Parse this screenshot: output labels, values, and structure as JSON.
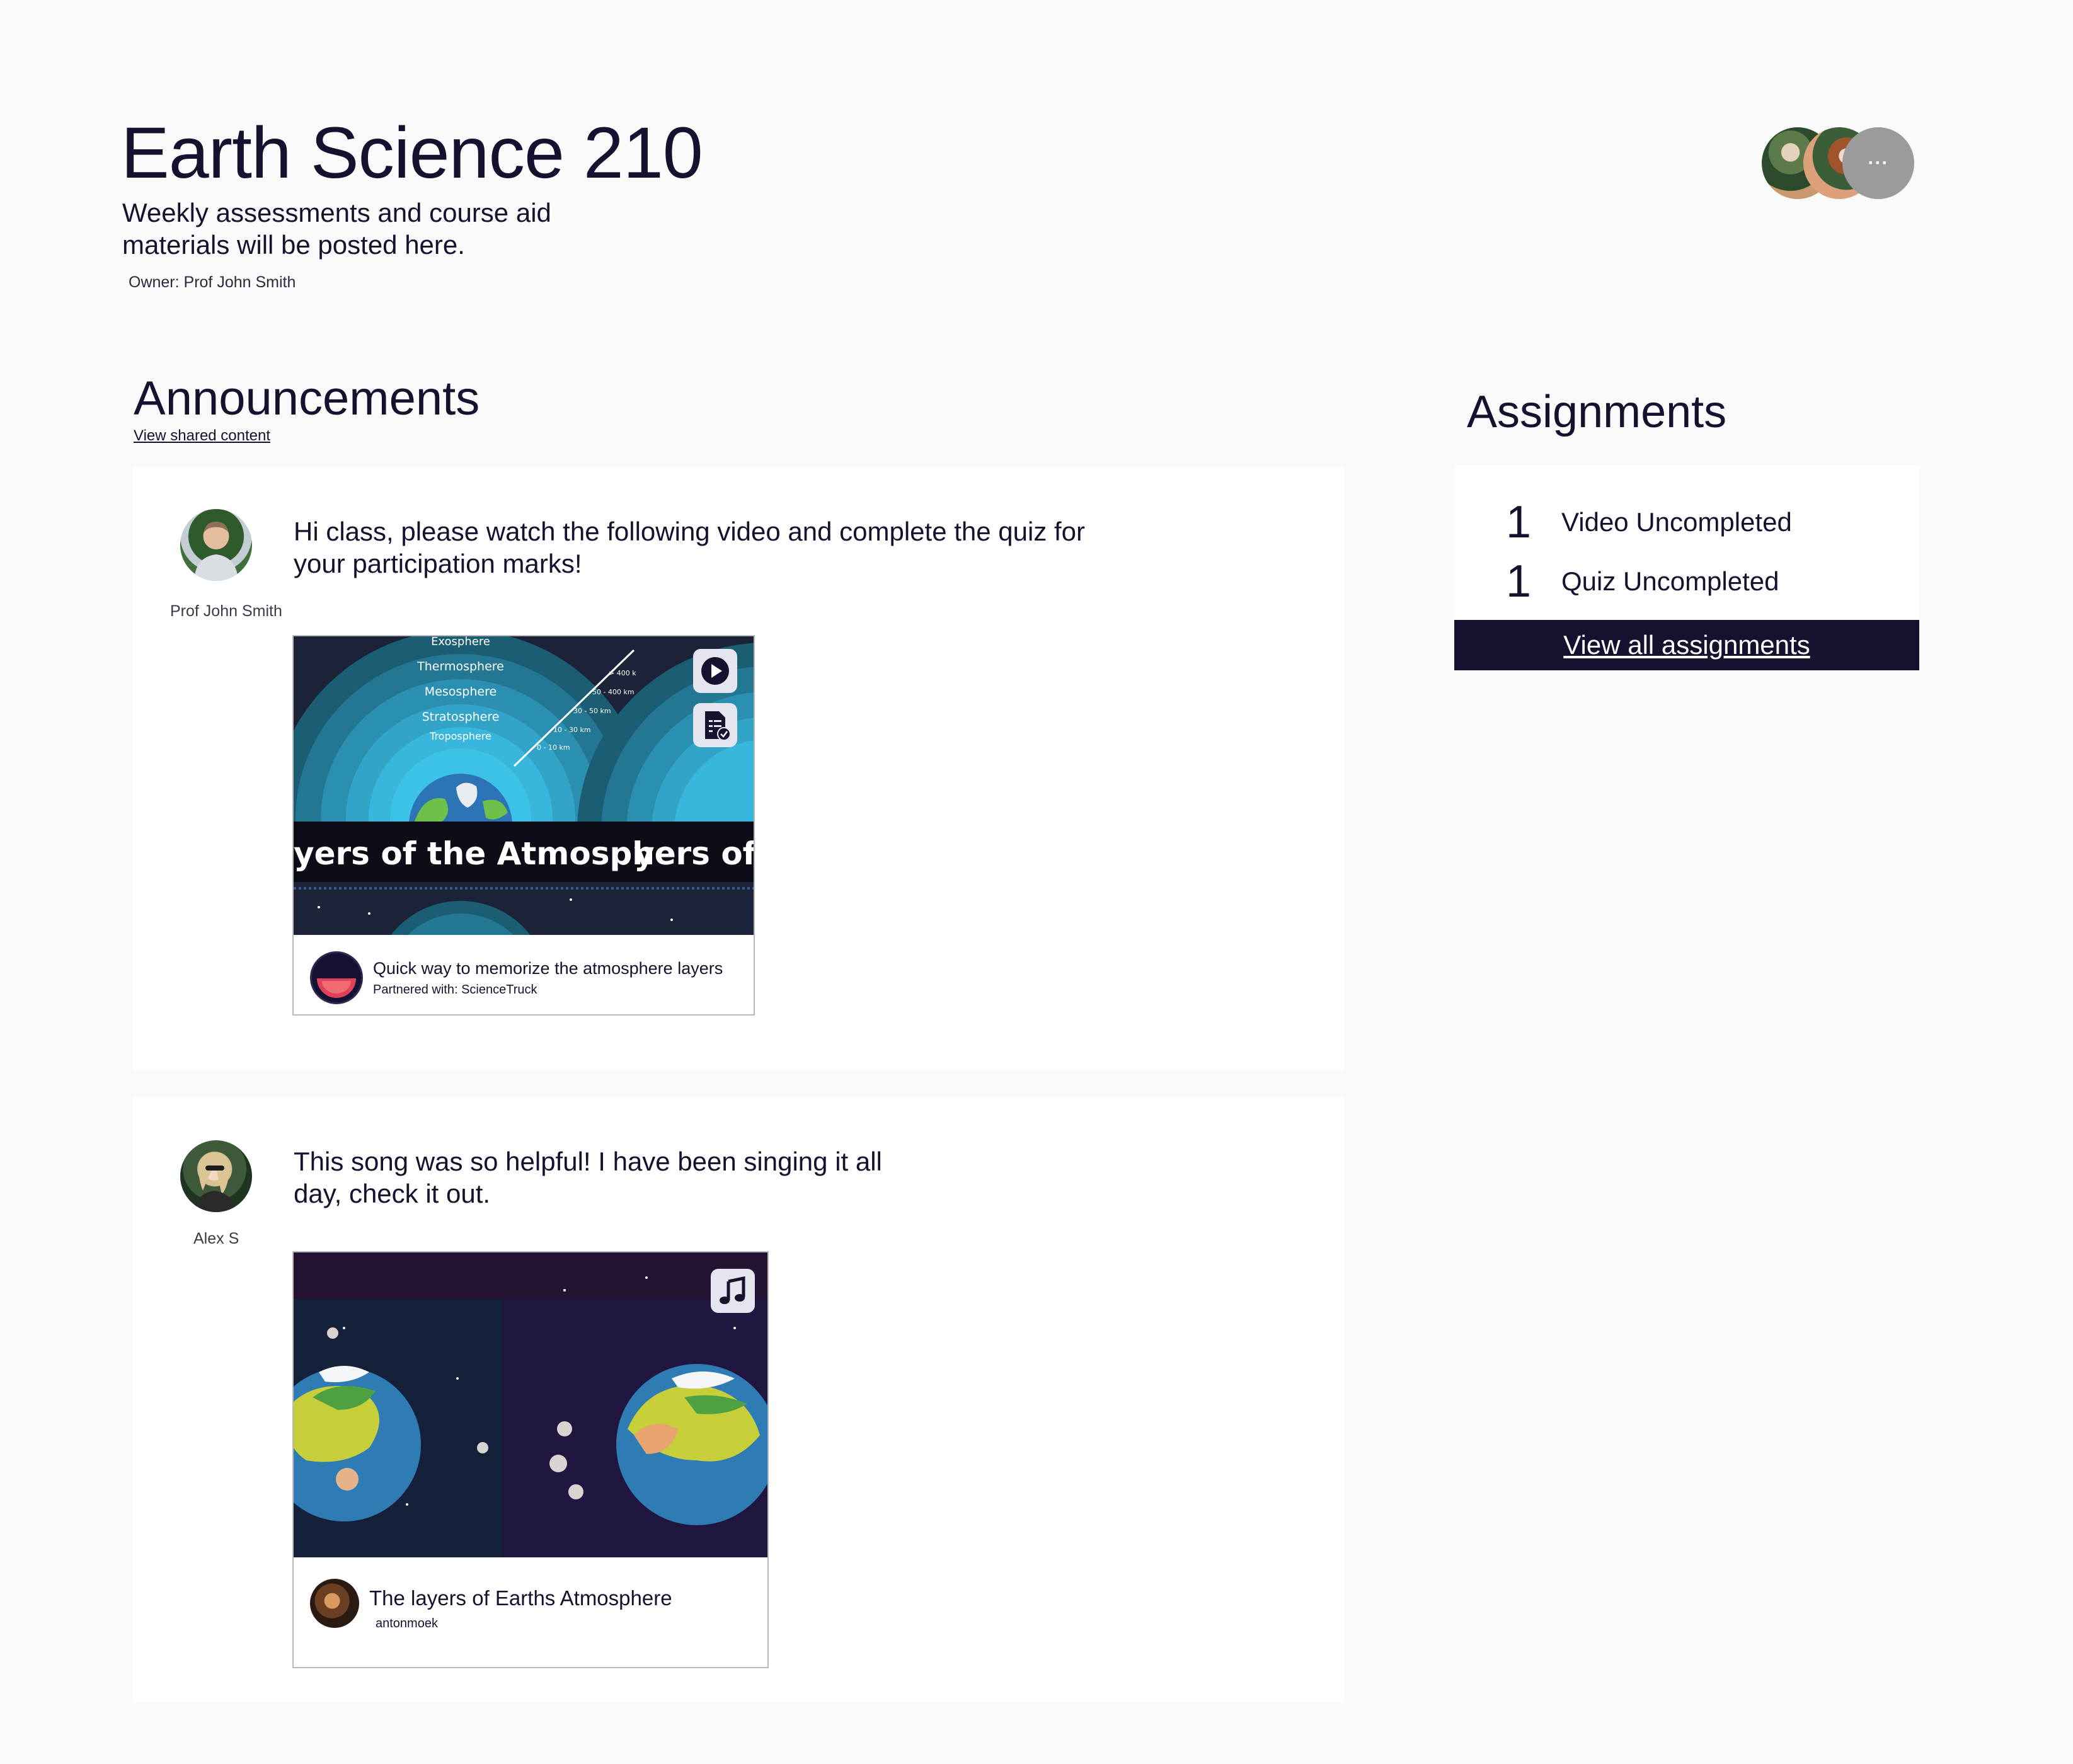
{
  "course": {
    "title": "Earth Science 210",
    "description": "Weekly assessments and course aid materials will be posted here.",
    "owner": "Owner: Prof John Smith"
  },
  "members": {
    "more_label": "···"
  },
  "announcements": {
    "title": "Announcements",
    "shared_link": "View shared content",
    "posts": [
      {
        "author": "Prof John Smith",
        "text": "Hi class, please watch the following video and complete the quiz for your participation marks!",
        "media": {
          "type": "video",
          "thumbnail_banner": "yers of the Atmosphe",
          "thumbnail_banner_repeat": "yers of t",
          "layer_labels": [
            "Exosphere",
            "Thermosphere",
            "Mesosphere",
            "Stratosphere",
            "Troposphere"
          ],
          "altitude_labels": [
            "> 400 k",
            "50 - 400 km",
            "30 - 50 km",
            "10 - 30 km",
            "0 - 10 km"
          ],
          "title": "Quick way to memorize the atmosphere layers",
          "subtitle": "Partnered with: ScienceTruck",
          "icons": [
            "play-icon",
            "quiz-icon"
          ]
        }
      },
      {
        "author": "Alex S",
        "text": "This song was so helpful! I have been singing it all day, check it out.",
        "media": {
          "type": "song",
          "title": "The layers of Earths Atmosphere",
          "subtitle": "antonmoek",
          "icons": [
            "music-note-icon"
          ]
        }
      }
    ]
  },
  "assignments": {
    "title": "Assignments",
    "items": [
      {
        "count": "1",
        "label": "Video Uncompleted"
      },
      {
        "count": "1",
        "label": "Quiz Uncompleted"
      }
    ],
    "view_all": "View all assignments"
  },
  "colors": {
    "primary": "#14122e",
    "background": "#f9fbfb",
    "card": "#ffffff"
  }
}
